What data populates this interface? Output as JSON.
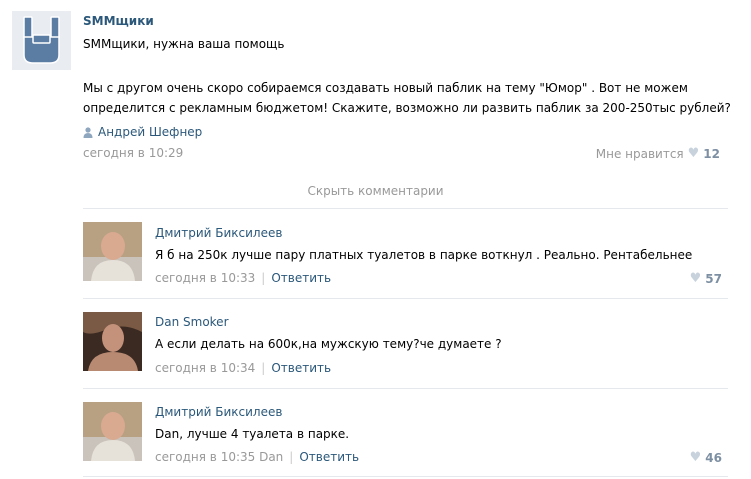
{
  "post": {
    "author": "SMMщики",
    "title_line": "SMMщики, нужна ваша помощь",
    "text": "Мы с другом очень скоро собираемся создавать новый паблик на тему \"Юмор\" . Вот не можем определится с рекламным бюджетом! Скажите, возможно ли развить паблик за 200-250тыс рублей?",
    "signer": "Андрей Шефнер",
    "date": "сегодня в 10:29",
    "like_label": "Мне нравится",
    "likes": "12"
  },
  "hide_comments": "Скрыть комментарии",
  "comments": [
    {
      "author": "Дмитрий Биксилеев",
      "text": "Я б на 250к лучше пару платных туалетов в парке воткнул . Реально. Рентабельнее",
      "date": "сегодня в 10:33",
      "reply": "Ответить",
      "likes": "57"
    },
    {
      "author": "Dan Smoker",
      "text": "А если делать на 600к,на мужскую тему?че думаете ?",
      "date": "сегодня в 10:34",
      "reply": "Ответить",
      "likes": ""
    },
    {
      "author": "Дмитрий Биксилеев",
      "text": "Dan, лучше 4 туалета в парке.",
      "date": "сегодня в 10:35 Dan",
      "reply": "Ответить",
      "likes": "46"
    }
  ],
  "icons": {
    "heart": "heart-icon",
    "user": "user-icon"
  },
  "colors": {
    "link": "#2b587a",
    "meta": "#999999",
    "like_count": "#7d8fa3"
  }
}
